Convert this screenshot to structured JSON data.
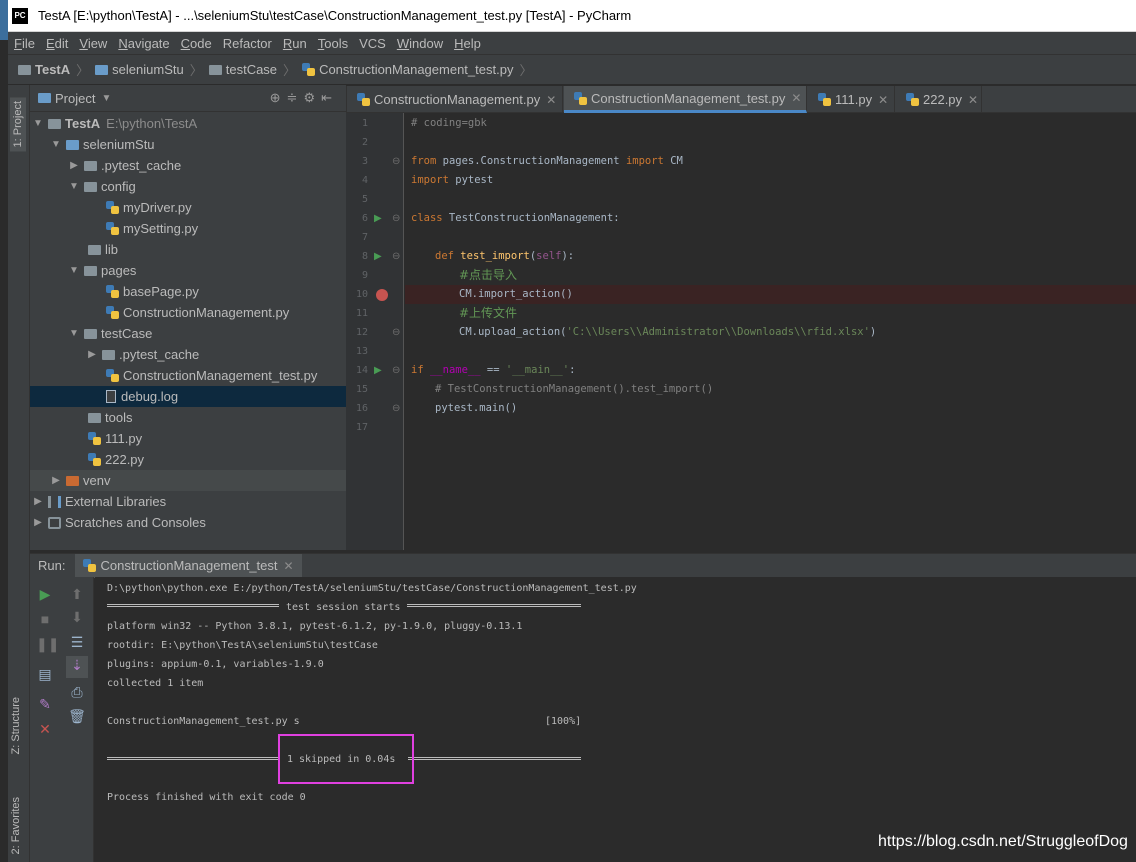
{
  "window": {
    "title": "TestA [E:\\python\\TestA] - ...\\seleniumStu\\testCase\\ConstructionManagement_test.py [TestA] - PyCharm",
    "logo": "PC"
  },
  "menu": [
    {
      "key": "F",
      "rest": "ile"
    },
    {
      "key": "E",
      "rest": "dit"
    },
    {
      "key": "V",
      "rest": "iew"
    },
    {
      "key": "N",
      "rest": "avigate"
    },
    {
      "key": "C",
      "rest": "ode"
    },
    {
      "key": "",
      "rest": "Refactor"
    },
    {
      "key": "R",
      "rest": "un"
    },
    {
      "key": "T",
      "rest": "ools"
    },
    {
      "key": "",
      "rest": "VCS"
    },
    {
      "key": "W",
      "rest": "indow"
    },
    {
      "key": "H",
      "rest": "elp"
    }
  ],
  "breadcrumb": [
    "TestA",
    "seleniumStu",
    "testCase",
    "ConstructionManagement_test.py"
  ],
  "side_tabs": {
    "project": "1: Project",
    "structure": "Z: Structure",
    "favorites": "2: Favorites"
  },
  "project": {
    "header": "Project",
    "root_name": "TestA",
    "root_path": "E:\\python\\TestA",
    "items": [
      "seleniumStu",
      ".pytest_cache",
      "config",
      "myDriver.py",
      "mySetting.py",
      "lib",
      "pages",
      "basePage.py",
      "ConstructionManagement.py",
      "testCase",
      ".pytest_cache",
      "ConstructionManagement_test.py",
      "debug.log",
      "tools",
      "111.py",
      "222.py",
      "venv",
      "External Libraries",
      "Scratches and Consoles"
    ]
  },
  "tabs": [
    "ConstructionManagement.py",
    "ConstructionManagement_test.py",
    "111.py",
    "222.py"
  ],
  "code": {
    "line_numbers": [
      "1",
      "2",
      "3",
      "4",
      "5",
      "6",
      "7",
      "8",
      "9",
      "10",
      "11",
      "12",
      "13",
      "14",
      "15",
      "16",
      "17"
    ],
    "l1": "# coding=gbk",
    "l3_from": "from",
    "l3_mod": " pages.ConstructionManagement ",
    "l3_import": "import",
    "l3_name": " CM",
    "l4_import": "import",
    "l4_mod": " pytest",
    "l6_class": "class",
    "l6_name": " TestConstructionManagement:",
    "l8_def": "def",
    "l8_fn": "test_import",
    "l8_open": "(",
    "l8_self": "self",
    "l8_close": "):",
    "l9": "#点击导入",
    "l10": "CM.import_action()",
    "l11": "#上传文件",
    "l12_a": "CM.upload_action(",
    "l12_s": "'C:\\\\Users\\\\Administrator\\\\Downloads\\\\rfid.xlsx'",
    "l12_b": ")",
    "l14_if": "if",
    "l14_name": " __name__ ",
    "l14_eq": "== ",
    "l14_main": "'__main__'",
    "l14_colon": ":",
    "l15": "# TestConstructionManagement().test_import()",
    "l16": "pytest.main()"
  },
  "run": {
    "label": "Run:",
    "tab": "ConstructionManagement_test",
    "lines": {
      "cmd": "D:\\python\\python.exe E:/python/TestA/seleniumStu/testCase/ConstructionManagement_test.py",
      "session": "test session starts",
      "platform": "platform win32 -- Python 3.8.1, pytest-6.1.2, py-1.9.0, pluggy-0.13.1",
      "rootdir": "rootdir: E:\\python\\TestA\\seleniumStu\\testCase",
      "plugins": "plugins: appium-0.1, variables-1.9.0",
      "collected": "collected 1 item",
      "result": "ConstructionManagement_test.py s",
      "percent": "[100%]",
      "summary": "1 skipped in 0.04s",
      "finished": "Process finished with exit code 0"
    }
  },
  "watermark": "https://blog.csdn.net/StruggleofDog",
  "colors": {
    "highlight_box": "#e040e0",
    "run_green": "#499c54",
    "stop_red": "#c75450"
  }
}
